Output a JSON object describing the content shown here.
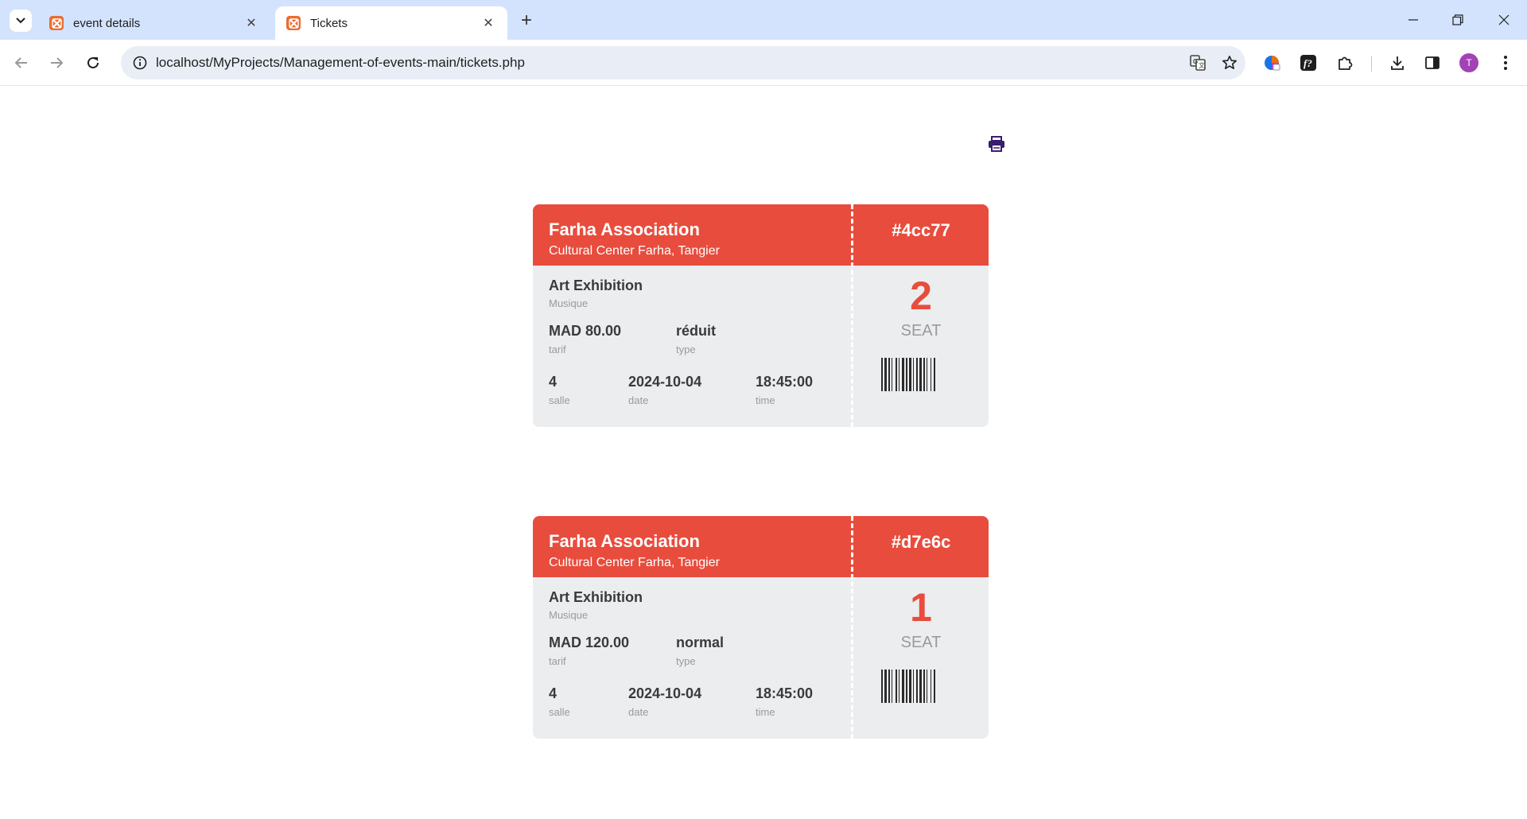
{
  "browser": {
    "tabs": [
      {
        "title": "event details",
        "active": false
      },
      {
        "title": "Tickets",
        "active": true
      }
    ],
    "url": "localhost/MyProjects/Management-of-events-main/tickets.php",
    "profile_initial": "T"
  },
  "colors": {
    "accent": "#e84c3d",
    "card_bg": "#ecedef",
    "print_icon": "#3a1d6e"
  },
  "print_icon": "printer-icon",
  "tickets": [
    {
      "organization": "Farha Association",
      "venue": "Cultural Center Farha, Tangier",
      "ticket_id": "#4cc77",
      "event_name": "Art Exhibition",
      "category": "Musique",
      "tarif_value": "MAD 80.00",
      "tarif_label": "tarif",
      "type_value": "réduit",
      "type_label": "type",
      "salle_value": "4",
      "salle_label": "salle",
      "date_value": "2024-10-04",
      "date_label": "date",
      "time_value": "18:45:00",
      "time_label": "time",
      "seat_number": "2",
      "seat_label": "SEAT"
    },
    {
      "organization": "Farha Association",
      "venue": "Cultural Center Farha, Tangier",
      "ticket_id": "#d7e6c",
      "event_name": "Art Exhibition",
      "category": "Musique",
      "tarif_value": "MAD 120.00",
      "tarif_label": "tarif",
      "type_value": "normal",
      "type_label": "type",
      "salle_value": "4",
      "salle_label": "salle",
      "date_value": "2024-10-04",
      "date_label": "date",
      "time_value": "18:45:00",
      "time_label": "time",
      "seat_number": "1",
      "seat_label": "SEAT"
    }
  ]
}
